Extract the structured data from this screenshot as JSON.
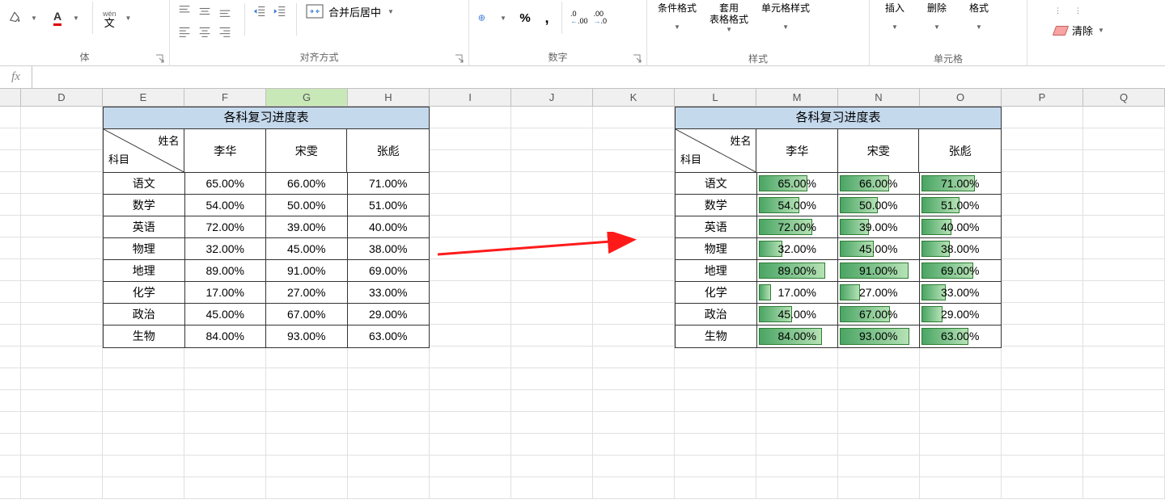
{
  "ribbon": {
    "font": {
      "group_label": "体"
    },
    "align": {
      "group_label": "对齐方式",
      "merge_label": "合并后居中"
    },
    "number": {
      "group_label": "数字"
    },
    "styles": {
      "group_label": "样式",
      "conditional": "条件格式",
      "table": "套用\n表格格式",
      "cellstyle": "单元格样式"
    },
    "cells": {
      "group_label": "单元格",
      "insert": "插入",
      "delete": "删除",
      "format": "格式"
    },
    "editing": {
      "clear": "清除"
    },
    "wen": "wén",
    "wen2": "文"
  },
  "columns": [
    "D",
    "E",
    "F",
    "G",
    "H",
    "I",
    "J",
    "K",
    "L",
    "M",
    "N",
    "O",
    "P",
    "Q"
  ],
  "selected_col": "G",
  "table": {
    "title": "各科复习进度表",
    "diag_top": "姓名",
    "diag_bottom": "科目",
    "names": [
      "李华",
      "宋雯",
      "张彪"
    ],
    "rows": [
      {
        "subject": "语文",
        "vals": [
          65.0,
          66.0,
          71.0
        ]
      },
      {
        "subject": "数学",
        "vals": [
          54.0,
          50.0,
          51.0
        ]
      },
      {
        "subject": "英语",
        "vals": [
          72.0,
          39.0,
          40.0
        ]
      },
      {
        "subject": "物理",
        "vals": [
          32.0,
          45.0,
          38.0
        ]
      },
      {
        "subject": "地理",
        "vals": [
          89.0,
          91.0,
          69.0
        ]
      },
      {
        "subject": "化学",
        "vals": [
          17.0,
          27.0,
          33.0
        ]
      },
      {
        "subject": "政治",
        "vals": [
          45.0,
          67.0,
          29.0
        ]
      },
      {
        "subject": "生物",
        "vals": [
          84.0,
          93.0,
          63.0
        ]
      }
    ]
  }
}
